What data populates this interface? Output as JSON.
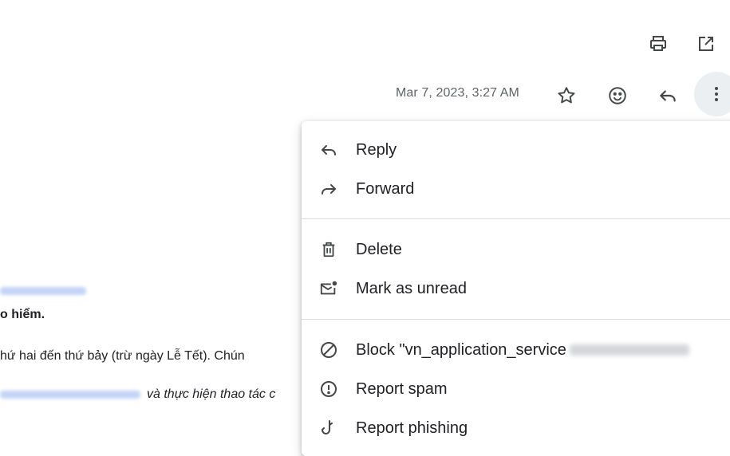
{
  "toolbar": {
    "print_icon": "printer-icon",
    "open_icon": "open-in-new-window-icon"
  },
  "header": {
    "date": "Mar 7, 2023, 3:27 AM",
    "star_icon": "star-outline-icon",
    "emoji_icon": "add-reaction-icon",
    "reply_icon": "reply-icon",
    "more_icon": "more-vert-icon"
  },
  "email_body": {
    "bold_line": "o hiểm.",
    "line1": "hứ hai đến thứ bảy (trừ ngày Lễ Tết). Chún",
    "line2": "và thực hiện thao tác c"
  },
  "menu": {
    "items": [
      {
        "label": "Reply",
        "icon": "reply-icon"
      },
      {
        "label": "Forward",
        "icon": "forward-icon"
      },
      {
        "label": "Delete",
        "icon": "trash-icon"
      },
      {
        "label": "Mark as unread",
        "icon": "mark-unread-icon"
      },
      {
        "label": "Block \"vn_application_service",
        "icon": "block-icon"
      },
      {
        "label": "Report spam",
        "icon": "report-spam-icon"
      },
      {
        "label": "Report phishing",
        "icon": "report-phishing-icon"
      }
    ]
  },
  "colors": {
    "accent_hover": "#eceff1",
    "icon_gray": "#5f6368",
    "text": "#202124"
  }
}
